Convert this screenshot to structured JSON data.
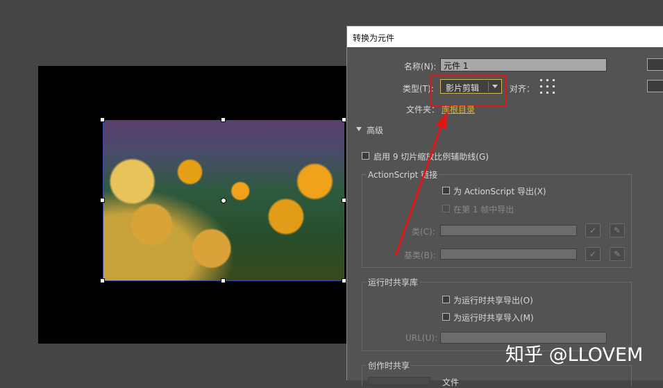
{
  "dialog": {
    "title": "转换为元件",
    "name_label": "名称(N):",
    "name_value": "元件 1",
    "type_label": "类型(T):",
    "type_value": "影片剪辑",
    "align_label": "对齐：",
    "folder_label": "文件夹：",
    "folder_value": "库根目录",
    "advanced_label": "高级",
    "nine_slice_label": "启用 9 切片缩放比例辅助线(G)",
    "actionscript": {
      "group_title": "ActionScript 链接",
      "export_as": "为 ActionScript 导出(X)",
      "export_frame1": "在第 1 帧中导出",
      "class_label": "类(C):",
      "base_class_label": "基类(B):"
    },
    "runtime_sharing": {
      "group_title": "运行时共享库",
      "export_runtime": "为运行时共享导出(O)",
      "import_runtime": "为运行时共享导入(M)",
      "url_label": "URL(U):"
    },
    "authoring_sharing": {
      "group_title": "创作时共享",
      "file_label": "文件"
    }
  },
  "watermark": "知乎 @LLOVEM",
  "colors": {
    "highlight_box": "#e01616",
    "arrow": "#e01616",
    "folder_link": "#e0b41c",
    "dialog_border": "#d27a1e"
  },
  "icons": {
    "check": "check-icon",
    "pencil": "pencil-icon",
    "expand": "triangle-down-icon"
  }
}
